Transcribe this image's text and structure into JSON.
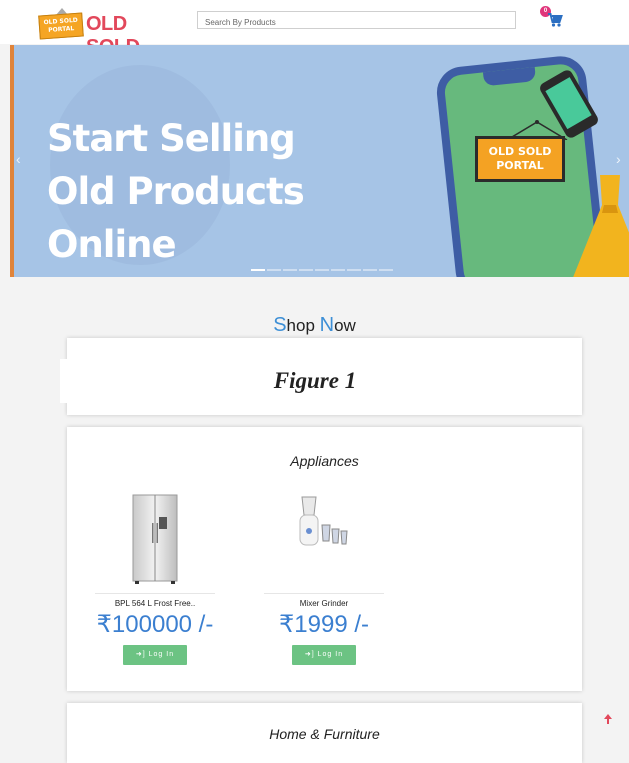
{
  "header": {
    "logo_sign": "OLD SOLD PORTAL",
    "logo_text": "OLD SOLD",
    "search_placeholder": "Search By Products",
    "cart_count": "0"
  },
  "banner": {
    "line1": "Start Selling",
    "line2": "Old Products",
    "line3": "Online",
    "sign_line1": "OLD SOLD",
    "sign_line2": "PORTAL",
    "prev": "‹",
    "next": "›"
  },
  "shop": {
    "title_cap1": "S",
    "title_rest1": "hop ",
    "title_cap2": "N",
    "title_rest2": "ow",
    "figure_caption": "Figure 1"
  },
  "sections": {
    "appliances": {
      "title": "Appliances",
      "products": [
        {
          "name": "BPL 564 L Frost Free..",
          "price": "₹100000 /-",
          "button": "Log In"
        },
        {
          "name": "Mixer Grinder",
          "price": "₹1999 /-",
          "button": "Log In"
        }
      ]
    },
    "home_furniture": {
      "title": "Home & Furniture"
    }
  },
  "colors": {
    "brand": "#e2485b",
    "accent": "#3b7fd0",
    "button": "#6cc383"
  }
}
